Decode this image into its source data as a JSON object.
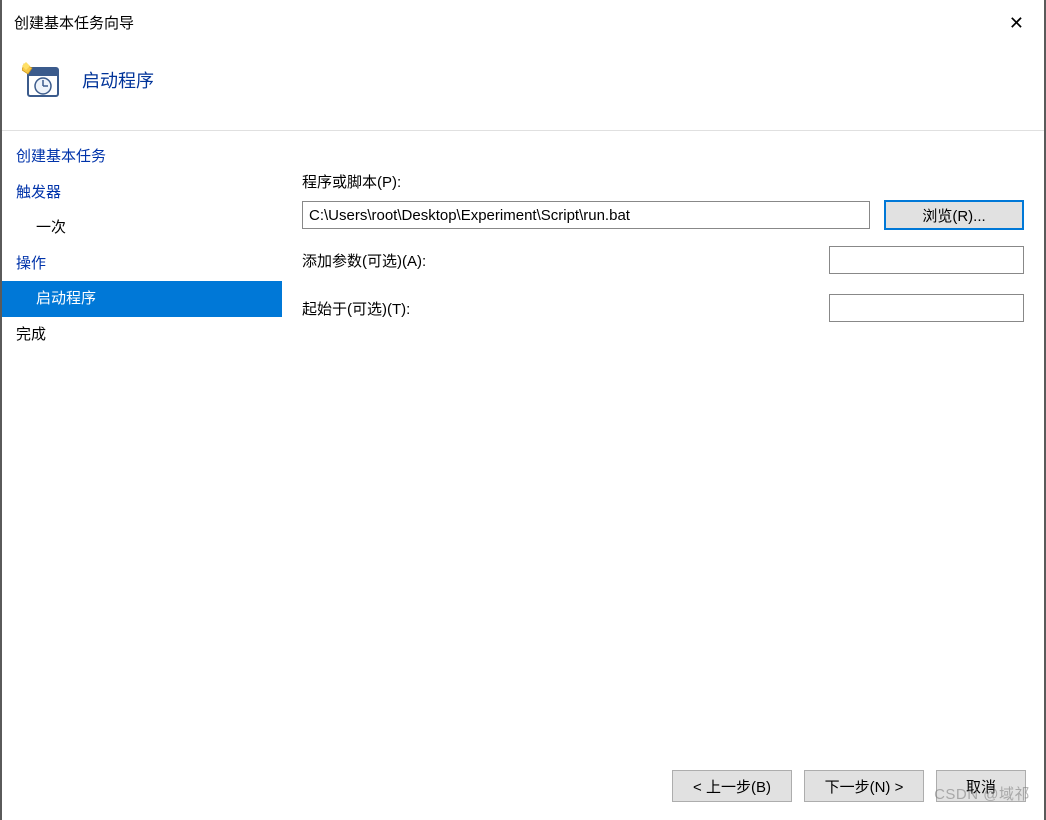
{
  "window": {
    "title": "创建基本任务向导",
    "close_glyph": "✕"
  },
  "header": {
    "title": "启动程序"
  },
  "sidebar": {
    "items": [
      {
        "label": "创建基本任务",
        "type": "link",
        "indent": false,
        "selected": false
      },
      {
        "label": "触发器",
        "type": "link",
        "indent": false,
        "selected": false
      },
      {
        "label": "一次",
        "type": "plain",
        "indent": true,
        "selected": false
      },
      {
        "label": "操作",
        "type": "link",
        "indent": false,
        "selected": false
      },
      {
        "label": "启动程序",
        "type": "plain",
        "indent": true,
        "selected": true
      },
      {
        "label": "完成",
        "type": "plain",
        "indent": false,
        "selected": false
      }
    ]
  },
  "form": {
    "program_label": "程序或脚本(P):",
    "program_value": "C:\\Users\\root\\Desktop\\Experiment\\Script\\run.bat",
    "browse_label": "浏览(R)...",
    "args_label": "添加参数(可选)(A):",
    "args_value": "",
    "startin_label": "起始于(可选)(T):",
    "startin_value": ""
  },
  "footer": {
    "back": "< 上一步(B)",
    "next": "下一步(N) >",
    "cancel": "取消"
  },
  "watermark": "CSDN @域祁"
}
